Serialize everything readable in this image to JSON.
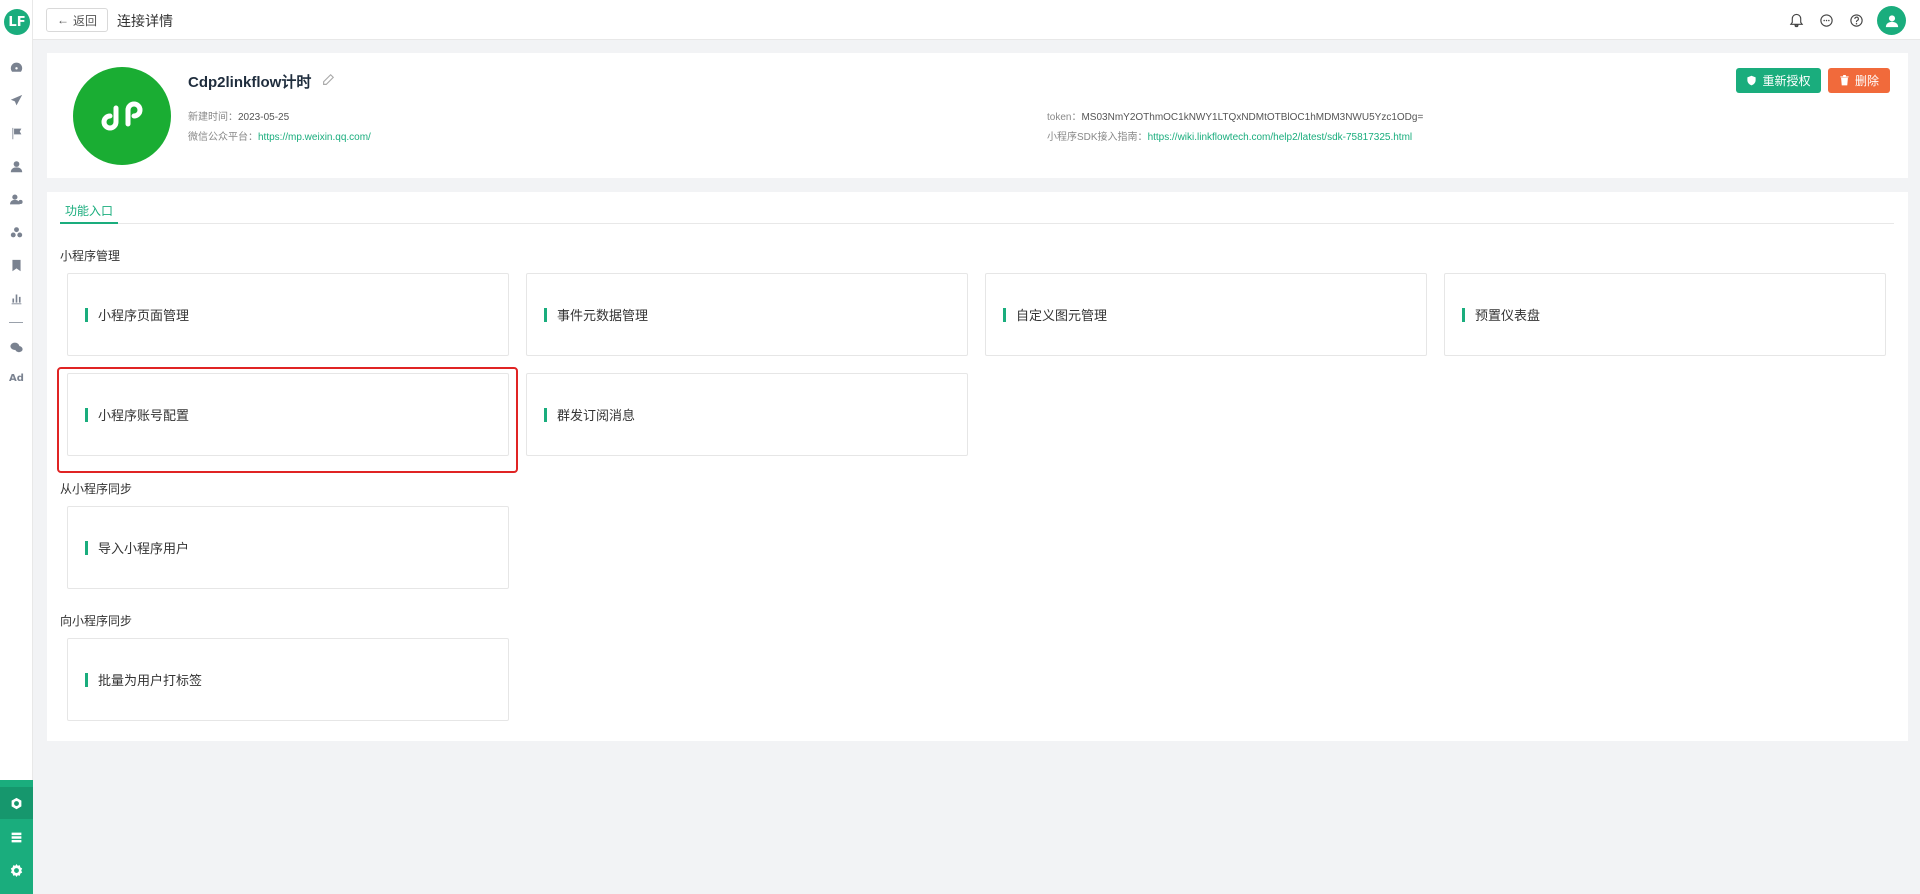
{
  "header": {
    "back_label": "返回",
    "title": "连接详情"
  },
  "connection": {
    "name": "Cdp2linkflow计时",
    "created_label": "新建时间：",
    "created_value": "2023-05-25",
    "platform_label": "微信公众平台：",
    "platform_url": "https://mp.weixin.qq.com/",
    "token_label": "token：",
    "token_value": "MS03NmY2OThmOC1kNWY1LTQxNDMtOTBlOC1hMDM3NWU5Yzc1ODg=",
    "sdk_label": "小程序SDK接入指南：",
    "sdk_url": "https://wiki.linkflowtech.com/help2/latest/sdk-75817325.html",
    "reauth_label": "重新授权",
    "delete_label": "删除"
  },
  "tabs": [
    {
      "label": "功能入口",
      "active": true
    }
  ],
  "sections": [
    {
      "title": "小程序管理",
      "items": [
        "小程序页面管理",
        "事件元数据管理",
        "自定义图元管理",
        "预置仪表盘",
        "小程序账号配置",
        "群发订阅消息"
      ]
    },
    {
      "title": "从小程序同步",
      "items": [
        "导入小程序用户"
      ]
    },
    {
      "title": "向小程序同步",
      "items": [
        "批量为用户打标签"
      ]
    }
  ],
  "rail": {
    "logo": "LF",
    "ad_label": "Ad"
  },
  "colors": {
    "accent": "#1aad7d",
    "danger": "#f16a3b",
    "highlight": "#e02424"
  }
}
